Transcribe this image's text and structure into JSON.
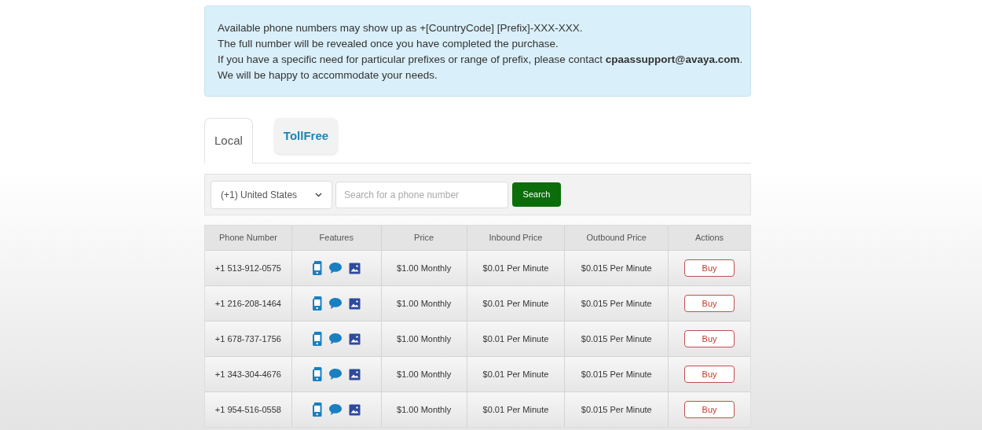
{
  "notice": {
    "lines": [
      "Available phone numbers may show up as +[CountryCode] [Prefix]-XXX-XXX.",
      "The full number will be revealed once you have completed the purchase.",
      "If you have a specific need for particular prefixes or range of prefix, please contact **cpaassupport@avaya.com**.",
      "We will be happy to accommodate your needs."
    ]
  },
  "tabs": [
    {
      "label": "Local",
      "selected": true
    },
    {
      "label": "TollFree",
      "selected": false
    }
  ],
  "search": {
    "country": "(+1) United States",
    "placeholder": "Search for a phone number",
    "button": "Search"
  },
  "table": {
    "columns": [
      "Phone Number",
      "Features",
      "Price",
      "Inbound Price",
      "Outbound Price",
      "Actions"
    ],
    "rows": [
      {
        "number": "+1 513-912-0575",
        "price": "$1.00 Monthly",
        "inbound": "$0.01 Per Minute",
        "outbound": "$0.015 Per Minute",
        "action": "Buy"
      },
      {
        "number": "+1 216-208-1464",
        "price": "$1.00 Monthly",
        "inbound": "$0.01 Per Minute",
        "outbound": "$0.015 Per Minute",
        "action": "Buy"
      },
      {
        "number": "+1 678-737-1756",
        "price": "$1.00 Monthly",
        "inbound": "$0.01 Per Minute",
        "outbound": "$0.015 Per Minute",
        "action": "Buy"
      },
      {
        "number": "+1 343-304-4676",
        "price": "$1.00 Monthly",
        "inbound": "$0.01 Per Minute",
        "outbound": "$0.015 Per Minute",
        "action": "Buy"
      },
      {
        "number": "+1 954-516-0558",
        "price": "$1.00 Monthly",
        "inbound": "$0.01 Per Minute",
        "outbound": "$0.015 Per Minute",
        "action": "Buy"
      }
    ]
  }
}
